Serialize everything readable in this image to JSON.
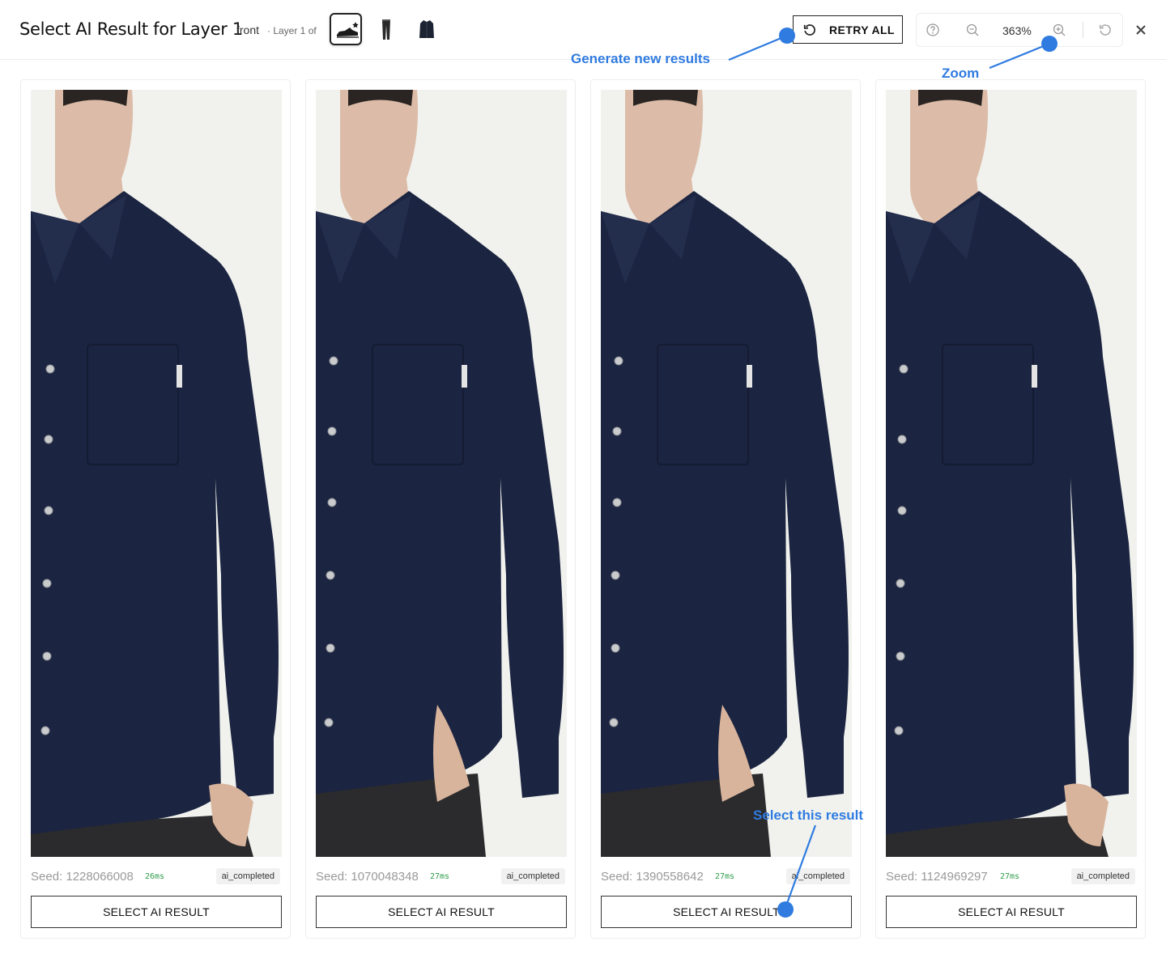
{
  "header": {
    "title": "Select AI Result for Layer 1",
    "view": "front",
    "layer_info": "· Layer 1 of",
    "thumbnails": [
      {
        "icon": "shoe-icon",
        "active": true
      },
      {
        "icon": "trousers-icon",
        "active": false
      },
      {
        "icon": "jacket-icon",
        "active": false
      }
    ],
    "retry_label": "RETRY ALL",
    "zoom_value": "363%"
  },
  "results": [
    {
      "seed": "Seed: 1228066008",
      "time": "26ms",
      "status": "ai_completed",
      "button": "SELECT AI RESULT"
    },
    {
      "seed": "Seed: 1070048348",
      "time": "27ms",
      "status": "ai_completed",
      "button": "SELECT AI RESULT"
    },
    {
      "seed": "Seed: 1390558642",
      "time": "27ms",
      "status": "ai_completed",
      "button": "SELECT AI RESULT"
    },
    {
      "seed": "Seed: 1124969297",
      "time": "27ms",
      "status": "ai_completed",
      "button": "SELECT AI RESULT"
    }
  ],
  "annotations": {
    "generate": "Generate new results",
    "zoom": "Zoom",
    "select": "Select this result"
  },
  "colors": {
    "annotation": "#2f7be0",
    "shirt": "#1b2440",
    "status_time": "#2e9d4a"
  }
}
